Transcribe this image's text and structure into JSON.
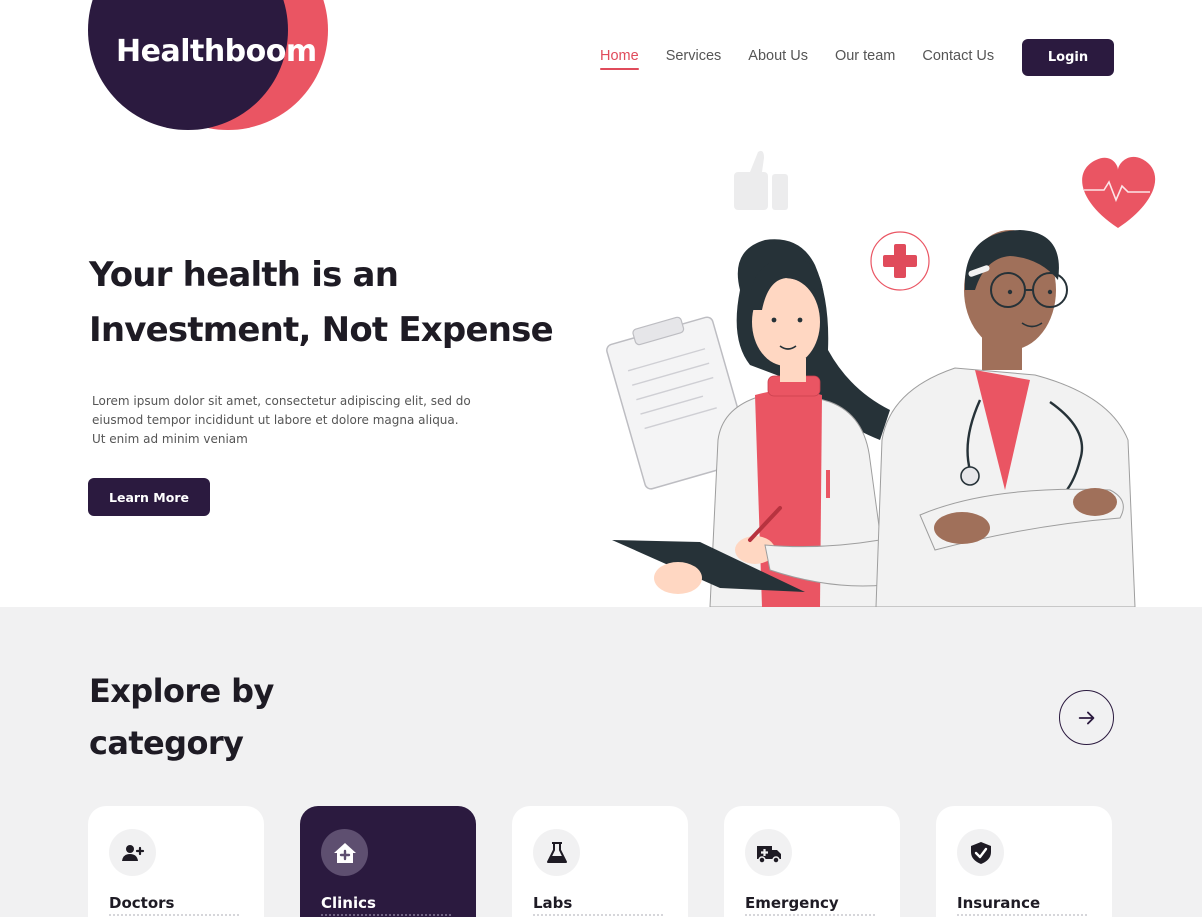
{
  "brand": {
    "name": "Healthboom"
  },
  "nav": {
    "items": [
      {
        "label": "Home",
        "active": true
      },
      {
        "label": "Services",
        "active": false
      },
      {
        "label": "About Us",
        "active": false
      },
      {
        "label": "Our team",
        "active": false
      },
      {
        "label": "Contact Us",
        "active": false
      }
    ],
    "login_label": "Login"
  },
  "hero": {
    "title_line1": "Your health is an",
    "title_line2": "Investment, Not Expense",
    "description": "Lorem ipsum dolor sit amet, consectetur adipiscing elit, sed do eiusmod tempor incididunt ut labore et dolore magna aliqua. Ut enim ad minim veniam",
    "cta_label": "Learn More"
  },
  "explore": {
    "title_line1": "Explore by",
    "title_line2": "category",
    "categories": [
      {
        "label": "Doctors",
        "icon": "add-user-icon",
        "active": false
      },
      {
        "label": "Clinics",
        "icon": "house-plus-icon",
        "active": true
      },
      {
        "label": "Labs",
        "icon": "flask-icon",
        "active": false
      },
      {
        "label": "Emergency",
        "icon": "ambulance-icon",
        "active": false
      },
      {
        "label": "Insurance",
        "icon": "shield-check-icon",
        "active": false
      }
    ]
  },
  "colors": {
    "primary_dark": "#2b1a3f",
    "accent_red": "#ea5563",
    "section_bg": "#f1f1f2"
  }
}
